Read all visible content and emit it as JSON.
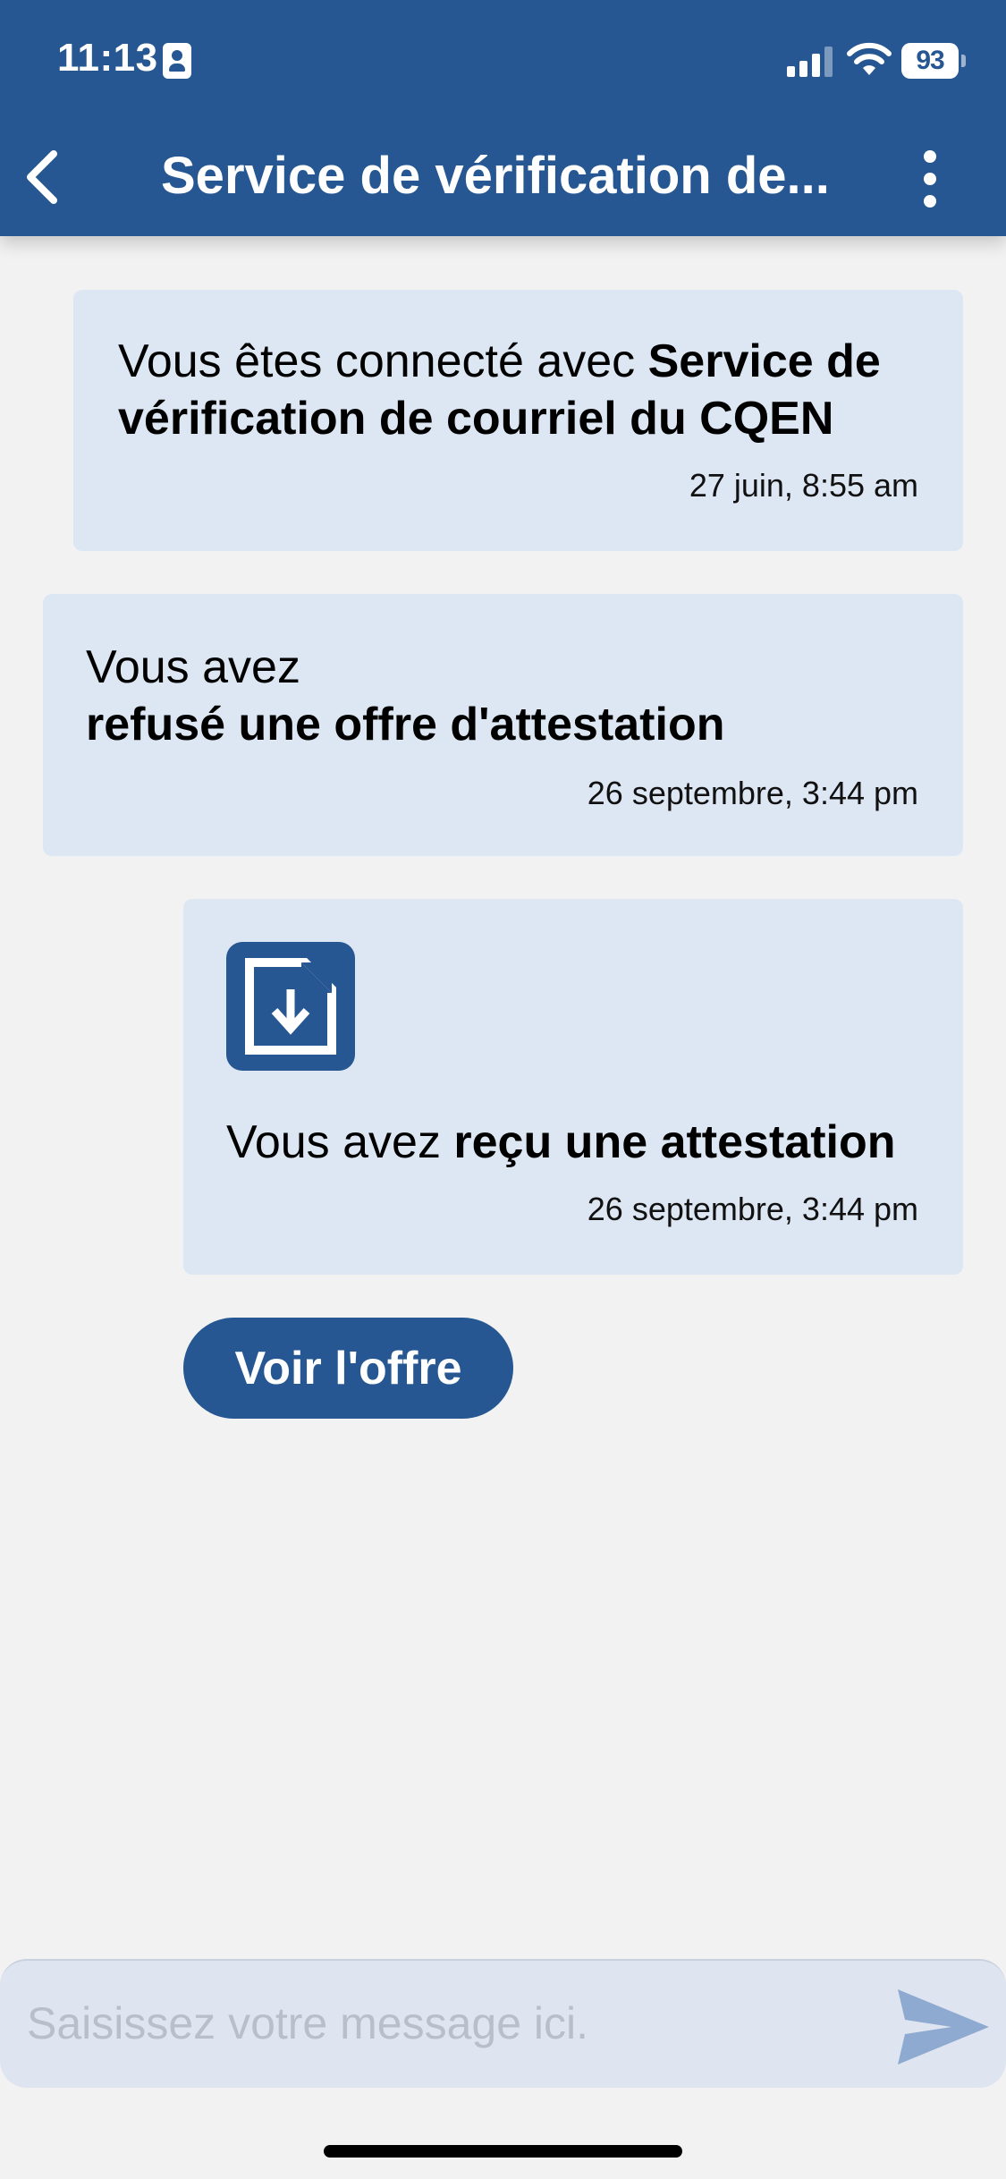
{
  "status_bar": {
    "time": "11:13",
    "battery": "93"
  },
  "header": {
    "title": "Service de vérification de..."
  },
  "messages": [
    {
      "text_plain": "Vous êtes connecté avec ",
      "text_bold": "Service de vérification de courriel du CQEN",
      "time": "27 juin, 8:55 am"
    },
    {
      "text_plain": "Vous avez",
      "text_bold": "refusé une offre d'attestation",
      "time": "26 septembre, 3:44 pm"
    },
    {
      "icon": "document-download-icon",
      "text_plain": "Vous avez ",
      "text_bold": "reçu une attestation",
      "time": "26 septembre, 3:44 pm"
    }
  ],
  "offer_button": {
    "label": "Voir l'offre"
  },
  "composer": {
    "placeholder": "Saisissez votre message ici."
  },
  "colors": {
    "primary": "#265792",
    "bubble": "#DDE7F3",
    "background": "#F2F2F2",
    "input_bar": "#DFE5F0",
    "send_icon": "#8FAAD0"
  }
}
